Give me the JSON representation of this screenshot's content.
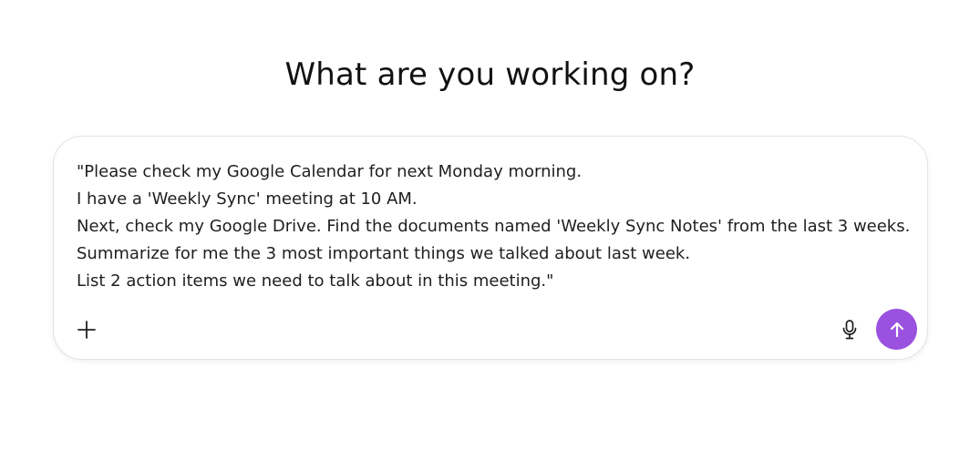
{
  "header": {
    "title": "What are you working on?"
  },
  "composer": {
    "lines": [
      "\"Please check my Google Calendar for next Monday morning.",
      "I have a 'Weekly Sync' meeting at 10 AM.",
      "Next, check my Google Drive. Find the documents named 'Weekly Sync Notes' from the last 3 weeks.",
      "Summarize for me the 3 most important things we talked about last week.",
      "List 2 action items we need to talk about in this meeting.\""
    ],
    "icons": {
      "add": "plus-icon",
      "voice": "microphone-icon",
      "send": "arrow-up-icon"
    },
    "send_color": "#9b51e0"
  }
}
